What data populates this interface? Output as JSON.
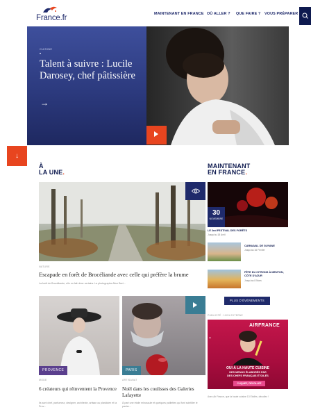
{
  "header": {
    "logo_text": "France.fr",
    "nav": [
      "MAINTENANT EN FRANCE",
      "OÙ ALLER ?",
      "QUE FAIRE ?",
      "VOUS PRÉPARER"
    ]
  },
  "hero": {
    "category": "CUISINE",
    "title": "Talent à suivre : Lucile Darosey, chef pâtissière",
    "arrow": "→"
  },
  "down_button": "↓",
  "a_la_une": {
    "heading_line1": "À",
    "heading_line2": "LA UNE",
    "heading_dot": ".",
    "featured": {
      "category": "NATURE",
      "title": "Escapade en forêt de Brocéliande avec celle qui préfère la brume",
      "description": "La forêt de Brocéliande, elle en fait rêver certains. La photographe Alice Bert..."
    },
    "cards": [
      {
        "tag": "PROVENCE",
        "category": "MODE",
        "title": "6 créateurs qui réinventent la Provence",
        "description": "Ils sont chef, parfumeur, designer, architecte, artisan ou plasticien et la Prov..."
      },
      {
        "tag": "PARIS",
        "category": "ARTISANAT",
        "title": "Noël dans les coulisses des Galeries Lafayette",
        "description": "À part une étoile minuscule et quelques paillettes qui font scintiller le panier..."
      }
    ]
  },
  "maintenant": {
    "heading_line1": "MAINTENANT",
    "heading_line2": "EN FRANCE",
    "heading_dot": ".",
    "main_event": {
      "day": "30",
      "month": "NOVEMBRE",
      "title": "LE 2nd FESTIVAL DES FORÊTS",
      "subtitle": "Jusqu'au 18 Avril"
    },
    "events": [
      {
        "title": "CARNAVAL DE GUYANE",
        "subtitle": "Jusqu'au 16 Février"
      },
      {
        "title": "FÊTE DU CITRONS À MENTON, CÔTE D'AZUR",
        "subtitle": "Jusqu'au 8 Mars"
      }
    ],
    "more_button": "PLUS D'ÉVÉNEMENTS",
    "ad_label": "PUBLICITÉ · 100% EXTERNE",
    "ad": {
      "brand": "AIRFRANCE",
      "line1": "OUI À LA HAUTE CUISINE",
      "line2": "DES MENUS ÉLABORÉS PAR",
      "line3": "DES CHEFS FRANÇAIS ÉTOILÉS",
      "button": "CLIQUEZ, DÉCOLLEZ",
      "close": "×"
    },
    "ad_note": "Avec Air France, que la haute cuisine 13 Etoilés, décollez !"
  },
  "colors": {
    "navy": "#1f2a6b",
    "accent": "#e8451f",
    "teal": "#3a7d94",
    "purple": "#5a3f8d"
  }
}
